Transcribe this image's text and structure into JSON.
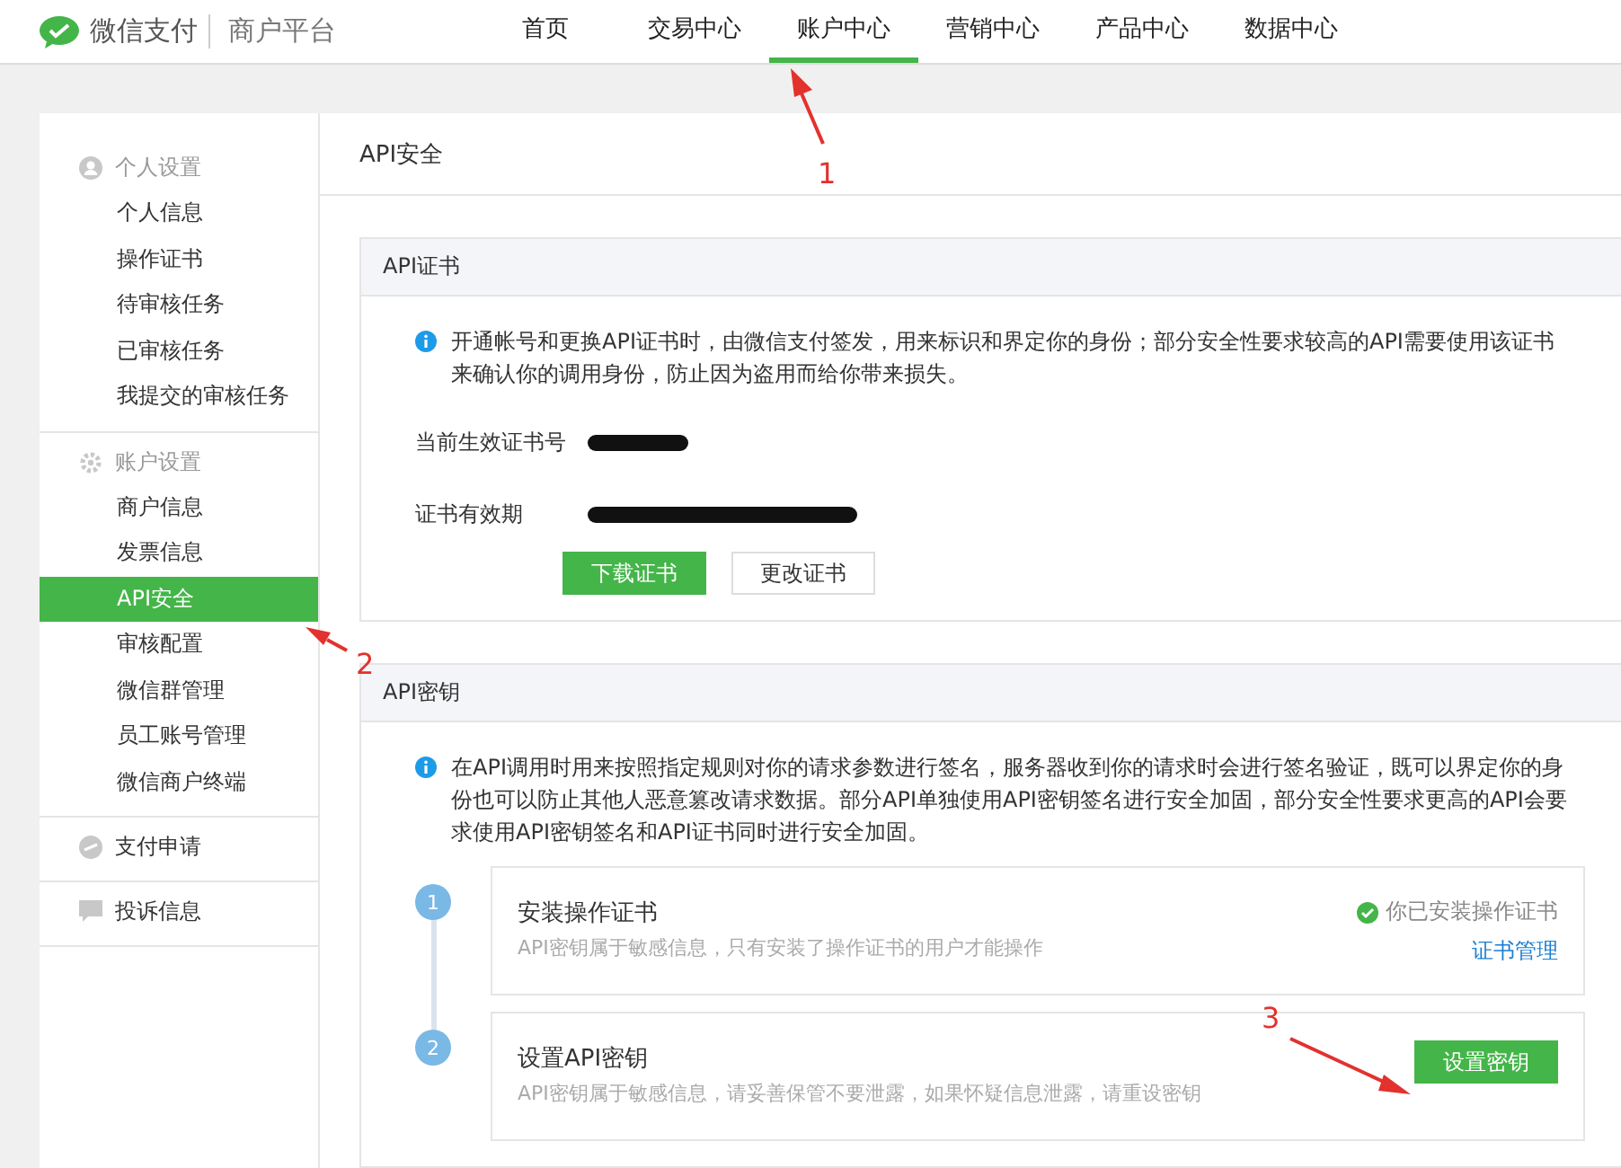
{
  "brand": {
    "name": "微信支付",
    "subtitle": "商户平台"
  },
  "nav": [
    {
      "label": "首页",
      "selected": false
    },
    {
      "label": "交易中心",
      "selected": false
    },
    {
      "label": "账户中心",
      "selected": true
    },
    {
      "label": "营销中心",
      "selected": false
    },
    {
      "label": "产品中心",
      "selected": false
    },
    {
      "label": "数据中心",
      "selected": false
    }
  ],
  "sidebar": [
    {
      "title": "个人设置",
      "kind": "user",
      "items": [
        {
          "label": "个人信息",
          "selected": false
        },
        {
          "label": "操作证书",
          "selected": false
        },
        {
          "label": "待审核任务",
          "selected": false
        },
        {
          "label": "已审核任务",
          "selected": false
        },
        {
          "label": "我提交的审核任务",
          "selected": false
        }
      ]
    },
    {
      "title": "账户设置",
      "kind": "gear",
      "items": [
        {
          "label": "商户信息",
          "selected": false
        },
        {
          "label": "发票信息",
          "selected": false
        },
        {
          "label": "API安全",
          "selected": true
        },
        {
          "label": "审核配置",
          "selected": false
        },
        {
          "label": "微信群管理",
          "selected": false
        },
        {
          "label": "员工账号管理",
          "selected": false
        },
        {
          "label": "微信商户终端",
          "selected": false
        }
      ]
    },
    {
      "title": "支付申请",
      "kind": "pay"
    },
    {
      "title": "投诉信息",
      "kind": "chat"
    }
  ],
  "page_title": "API安全",
  "certificate": {
    "title": "API证书",
    "notice": "开通帐号和更换API证书时，由微信支付签发，用来标识和界定你的身份；部分安全性要求较高的API需要使用该证书来确认你的调用身份，防止因为盗用而给你带来损失。",
    "fields": [
      {
        "label": "当前生效证书号"
      },
      {
        "label": "证书有效期"
      }
    ],
    "buttons": [
      {
        "label": "下载证书",
        "kind": "primary"
      },
      {
        "label": "更改证书",
        "kind": "default"
      }
    ]
  },
  "api_key": {
    "title": "API密钥",
    "notice": "在API调用时用来按照指定规则对你的请求参数进行签名，服务器收到你的请求时会进行签名验证，既可以界定你的身份也可以防止其他人恶意篡改请求数据。部分API单独使用API密钥签名进行安全加固，部分安全性要求更高的API会要求使用API密钥签名和API证书同时进行安全加固。",
    "steps": [
      {
        "number": "1",
        "title": "安装操作证书",
        "description": "API密钥属于敏感信息，只有安装了操作证书的用户才能操作",
        "kind": "status",
        "status": "你已安装操作证书",
        "link": "证书管理"
      },
      {
        "number": "2",
        "title": "设置API密钥",
        "description": "API密钥属于敏感信息，请妥善保管不要泄露，如果怀疑信息泄露，请重设密钥",
        "kind": "button",
        "button": "设置密钥"
      }
    ]
  },
  "annotations": [
    {
      "label": "1"
    },
    {
      "label": "2"
    },
    {
      "label": "3"
    }
  ]
}
